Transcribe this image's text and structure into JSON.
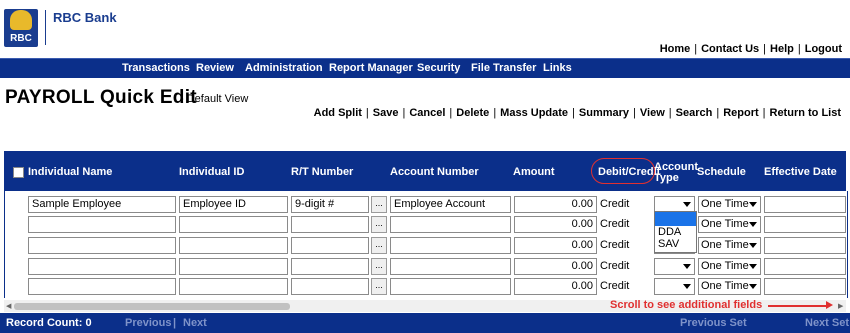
{
  "brand": {
    "logo_text": "RBC",
    "bank_name": "RBC Bank"
  },
  "top_links": [
    "Home",
    "Contact Us",
    "Help",
    "Logout"
  ],
  "nav": [
    "Transactions",
    "Review",
    "Administration",
    "Report Manager",
    "Security",
    "File Transfer",
    "Links"
  ],
  "page": {
    "title": "PAYROLL Quick Edit",
    "subtitle": "- Default View"
  },
  "actions": [
    "Add Split",
    "Save",
    "Cancel",
    "Delete",
    "Mass Update",
    "Summary",
    "View",
    "Search",
    "Report",
    "Return to List"
  ],
  "columns": {
    "individual_name": "Individual Name",
    "individual_id": "Individual ID",
    "rt_number": "R/T Number",
    "account_number": "Account Number",
    "amount": "Amount",
    "debit_credit": "Debit/Credit",
    "account_type_1": "Account",
    "account_type_2": "Type",
    "schedule": "Schedule",
    "effective_date": "Effective Date"
  },
  "rows": [
    {
      "name": "Sample Employee",
      "id": "Employee ID",
      "rt": "9-digit #",
      "account": "Employee Account",
      "amount": "0.00",
      "dc": "Credit",
      "type": "",
      "schedule": "One Time",
      "date": ""
    },
    {
      "name": "",
      "id": "",
      "rt": "",
      "account": "",
      "amount": "0.00",
      "dc": "Credit",
      "type": "",
      "schedule": "One Time",
      "date": ""
    },
    {
      "name": "",
      "id": "",
      "rt": "",
      "account": "",
      "amount": "0.00",
      "dc": "Credit",
      "type": "",
      "schedule": "One Time",
      "date": ""
    },
    {
      "name": "",
      "id": "",
      "rt": "",
      "account": "",
      "amount": "0.00",
      "dc": "Credit",
      "type": "",
      "schedule": "One Time",
      "date": ""
    },
    {
      "name": "",
      "id": "",
      "rt": "",
      "account": "",
      "amount": "0.00",
      "dc": "Credit",
      "type": "",
      "schedule": "One Time",
      "date": ""
    }
  ],
  "lookup_button": "...",
  "account_type_options": [
    "",
    "DDA",
    "SAV"
  ],
  "scroll_note": "Scroll to see additional fields",
  "footer": {
    "record_count": "Record Count: 0",
    "previous": "Previous",
    "next": "Next",
    "previous_set": "Previous Set",
    "next_set": "Next Set"
  },
  "colors": {
    "nav_bg": "#0b2f8a",
    "annotation": "#e03030",
    "brand_blue": "#1a3d8f",
    "brand_gold": "#e8b92b"
  }
}
